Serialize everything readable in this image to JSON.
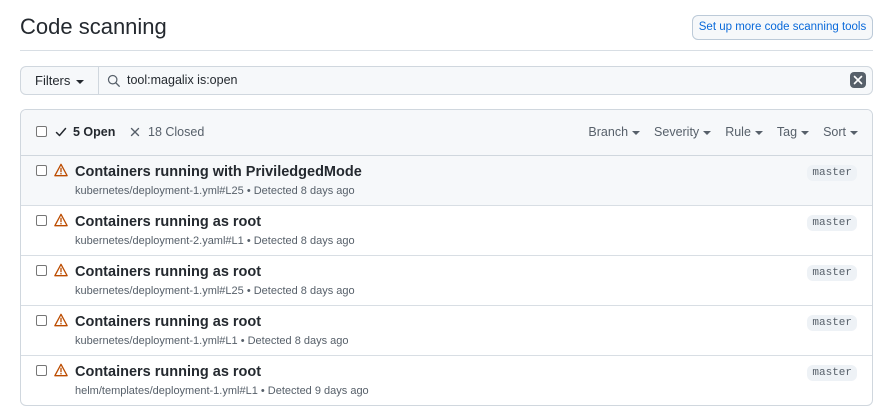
{
  "header": {
    "title": "Code scanning",
    "setup_button": "Set up more code scanning tools"
  },
  "filter_bar": {
    "filters_label": "Filters",
    "search_value": "tool:magalix is:open"
  },
  "list_header": {
    "open_label": "5 Open",
    "closed_label": "18 Closed",
    "menus": [
      "Branch",
      "Severity",
      "Rule",
      "Tag",
      "Sort"
    ]
  },
  "alerts": [
    {
      "title": "Containers running with PriviledgedMode",
      "meta": "kubernetes/deployment-1.yml#L25 • Detected 8 days ago",
      "branch": "master"
    },
    {
      "title": "Containers running as root",
      "meta": "kubernetes/deployment-2.yaml#L1 • Detected 8 days ago",
      "branch": "master"
    },
    {
      "title": "Containers running as root",
      "meta": "kubernetes/deployment-1.yml#L25 • Detected 8 days ago",
      "branch": "master"
    },
    {
      "title": "Containers running as root",
      "meta": "kubernetes/deployment-1.yml#L1 • Detected 8 days ago",
      "branch": "master"
    },
    {
      "title": "Containers running as root",
      "meta": "helm/templates/deployment-1.yml#L1 • Detected 9 days ago",
      "branch": "master"
    }
  ],
  "colors": {
    "warning": "#bc4c00",
    "link": "#0969da",
    "border": "#d0d7de"
  }
}
